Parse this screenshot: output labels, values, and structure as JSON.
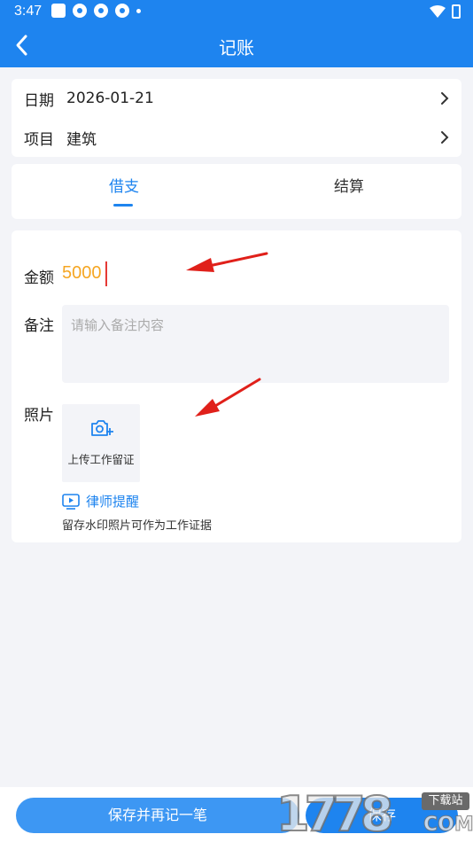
{
  "status_bar": {
    "time": "3:47"
  },
  "header": {
    "title": "记账"
  },
  "info": {
    "date_label": "日期",
    "date_value": "2026-01-21",
    "project_label": "项目",
    "project_value": "建筑"
  },
  "tabs": [
    {
      "label": "借支",
      "active": true
    },
    {
      "label": "结算",
      "active": false
    }
  ],
  "form": {
    "amount_label": "金额",
    "amount_value": "5000",
    "note_label": "备注",
    "note_placeholder": "请输入备注内容",
    "photo_label": "照片",
    "upload_label": "上传工作留证",
    "lawyer_link": "律师提醒",
    "hint": "留存水印照片可作为工作证据"
  },
  "buttons": {
    "save_and_next": "保存并再记一笔",
    "save": "保存"
  },
  "watermark": {
    "digits": "1778",
    "badge": "下载站",
    "domain": "COM"
  },
  "colors": {
    "primary": "#1e84ef",
    "amount": "#f5a623",
    "arrow": "#e0201a"
  },
  "icons": [
    "back-icon",
    "chevron-right-icon",
    "camera-plus-icon",
    "play-icon"
  ]
}
